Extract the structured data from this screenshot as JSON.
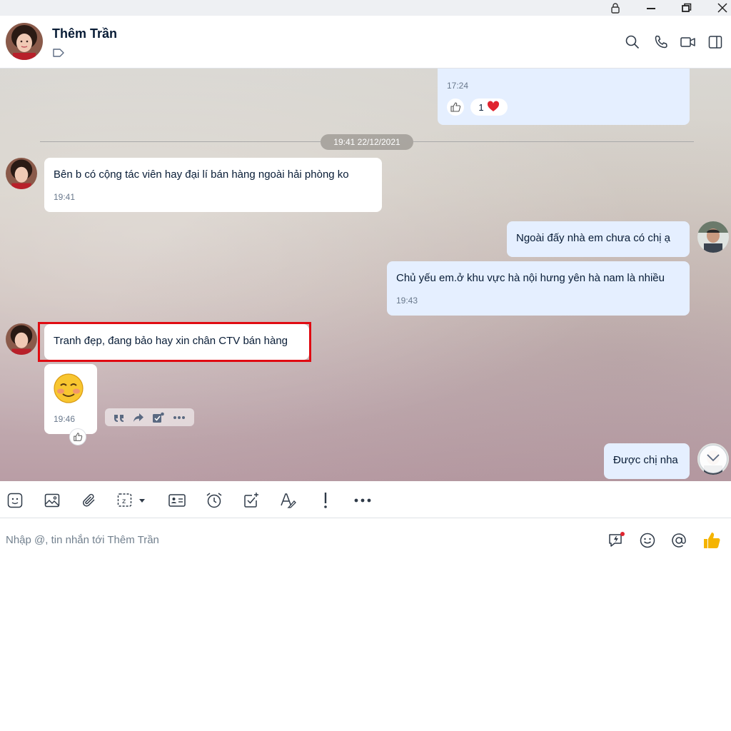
{
  "window": {
    "controls": [
      "lock-icon",
      "minimize-icon",
      "restore-icon",
      "close-icon"
    ]
  },
  "header": {
    "contact_name": "Thêm Trần",
    "actions": [
      "search-icon",
      "phone-icon",
      "video-icon",
      "side-panel-icon"
    ]
  },
  "chat": {
    "prev_message": {
      "time": "17:24",
      "reaction_count": "1"
    },
    "date_divider": "19:41 22/12/2021",
    "messages": [
      {
        "side": "in",
        "text": "Bên b có cộng tác viên hay đại lí bán hàng ngoài hải phòng ko",
        "time": "19:41"
      },
      {
        "side": "out",
        "text": "Ngoài đấy nhà em chưa có chị ạ",
        "time": ""
      },
      {
        "side": "out",
        "text": "Chủ yếu em.ở khu vực hà nội hưng yên hà nam là nhiều",
        "time": "19:43"
      },
      {
        "side": "in",
        "text": "Tranh đẹp, đang bảo hay xin chân CTV bán hàng",
        "time": ""
      },
      {
        "side": "in",
        "text": "",
        "sticker": "smiling-face-emoji",
        "time": "19:46"
      },
      {
        "side": "out",
        "text": "Được chị nha",
        "time": ""
      }
    ],
    "hover_actions": [
      "quote-icon",
      "forward-icon",
      "task-icon",
      "more-icon"
    ]
  },
  "toolbar": {
    "tools": [
      "sticker-icon",
      "image-icon",
      "attachment-icon",
      "screenshot-icon",
      "contact-card-icon",
      "reminder-icon",
      "todo-icon",
      "text-format-icon",
      "important-icon",
      "more-icon"
    ]
  },
  "composer": {
    "placeholder": "Nhập @, tin nhắn tới Thêm Trần",
    "value": "",
    "actions": [
      "quick-message-icon",
      "emoji-icon",
      "mention-icon",
      "like-icon"
    ]
  },
  "colors": {
    "accent_blue": "#0068ff",
    "out_bubble": "#e5efff",
    "in_bubble": "#ffffff",
    "highlight_red": "#e00b12",
    "like_yellow": "#f5b400"
  }
}
